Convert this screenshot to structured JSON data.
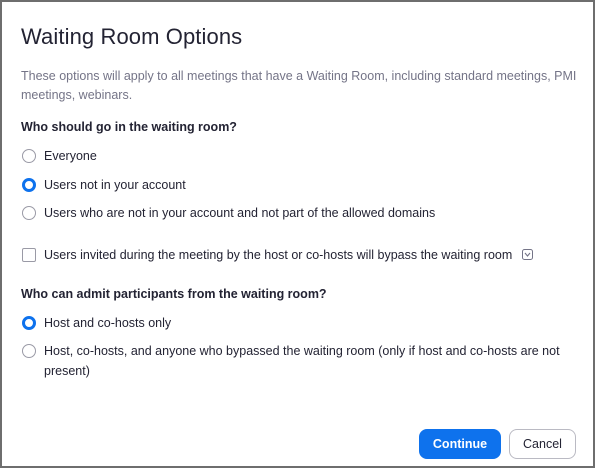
{
  "dialog": {
    "title": "Waiting Room Options",
    "description": "These options will apply to all meetings that have a Waiting Room, including standard meetings, PMI meetings, webinars."
  },
  "who_goes": {
    "label": "Who should go in the waiting room?",
    "options": [
      {
        "label": "Everyone",
        "selected": false
      },
      {
        "label": "Users not in your account",
        "selected": true
      },
      {
        "label": "Users who are not in your account and not part of the allowed domains",
        "selected": false
      }
    ]
  },
  "bypass": {
    "label": "Users invited during the meeting by the host or co-hosts will bypass the waiting room",
    "checked": false,
    "icon": "info-icon"
  },
  "who_admits": {
    "label": "Who can admit participants from the waiting room?",
    "options": [
      {
        "label": "Host and co-hosts only",
        "selected": true
      },
      {
        "label": "Host, co-hosts, and anyone who bypassed the waiting room (only if host and co-hosts are not present)",
        "selected": false
      }
    ]
  },
  "buttons": {
    "continue": "Continue",
    "cancel": "Cancel"
  },
  "colors": {
    "accent": "#0e72ed",
    "text": "#232333",
    "muted": "#747487"
  }
}
